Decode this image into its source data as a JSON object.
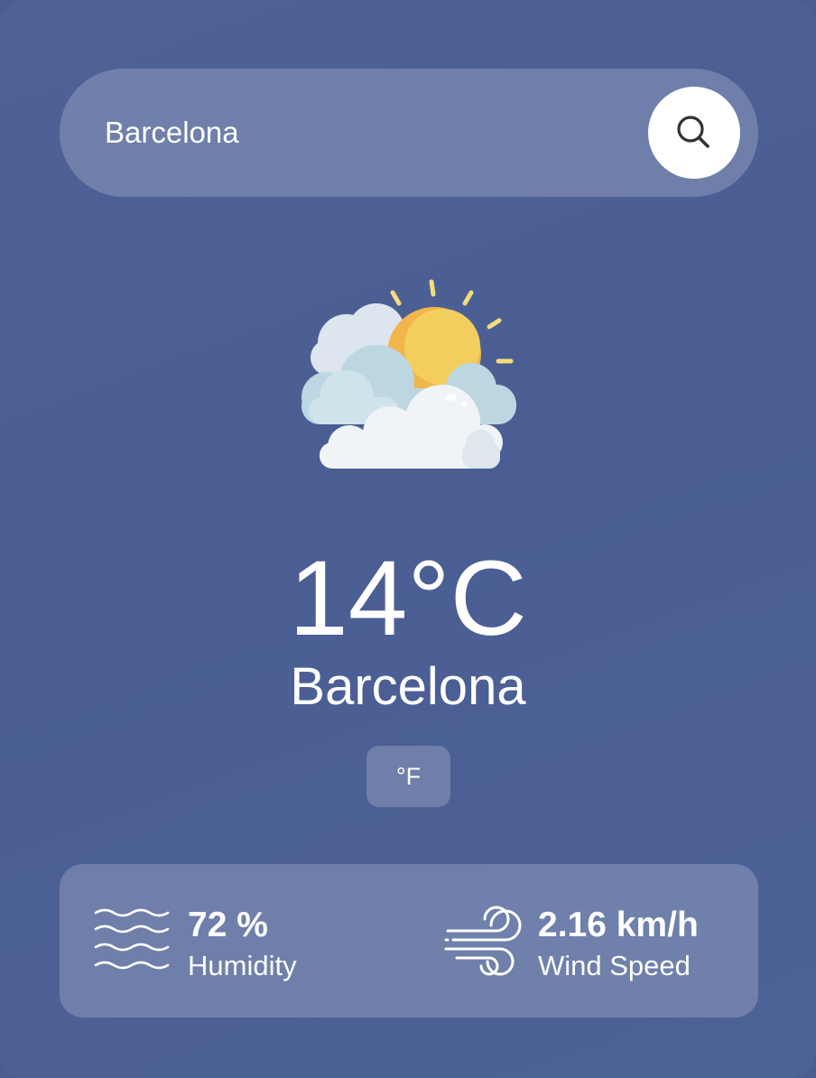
{
  "search": {
    "value": "Barcelona",
    "placeholder": "",
    "button_icon": "search-icon"
  },
  "weather": {
    "icon": "partly-cloudy-sun-icon",
    "temperature": "14°C",
    "city": "Barcelona",
    "unit_toggle_label": "°F"
  },
  "details": {
    "humidity": {
      "icon": "humidity-waves-icon",
      "value": "72 %",
      "label": "Humidity"
    },
    "wind": {
      "icon": "wind-icon",
      "value": "2.16 km/h",
      "label": "Wind Speed"
    }
  },
  "colors": {
    "background": "#4a5d92",
    "panel": "rgba(255,255,255,0.2)",
    "text": "#ffffff",
    "sun": "#f2b84b"
  }
}
